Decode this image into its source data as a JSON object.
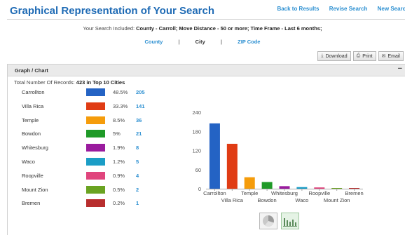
{
  "header": {
    "title": "Graphical Representation of Your Search",
    "links": [
      "Back to Results",
      "Revise Search",
      "New Search"
    ]
  },
  "criteria": {
    "prefix": "Your Search Included:",
    "value": "County - Carroll; Move Distance - 50 or more; Time Frame - Last 6 months;"
  },
  "view_tabs": [
    {
      "label": "County",
      "current": false
    },
    {
      "label": "City",
      "current": true
    },
    {
      "label": "ZIP Code",
      "current": false
    }
  ],
  "actions": [
    {
      "label": "Download",
      "icon": "download-icon"
    },
    {
      "label": "Print",
      "icon": "print-icon"
    },
    {
      "label": "Email",
      "icon": "email-icon"
    }
  ],
  "panel": {
    "title": "Graph / Chart",
    "collapse": "−"
  },
  "total": {
    "label": "Total Number Of Records:",
    "value": "423 in Top 10 Cities"
  },
  "cities": [
    {
      "name": "Carrollton",
      "color": "#2463c4",
      "pct": "48.5%",
      "count": "205"
    },
    {
      "name": "Villa Rica",
      "color": "#e03c14",
      "pct": "33.3%",
      "count": "141"
    },
    {
      "name": "Temple",
      "color": "#f59c0b",
      "pct": "8.5%",
      "count": "36"
    },
    {
      "name": "Bowdon",
      "color": "#1f9a27",
      "pct": "5%",
      "count": "21"
    },
    {
      "name": "Whitesburg",
      "color": "#9a1b9e",
      "pct": "1.9%",
      "count": "8"
    },
    {
      "name": "Waco",
      "color": "#1b9dc6",
      "pct": "1.2%",
      "count": "5"
    },
    {
      "name": "Roopville",
      "color": "#e0457d",
      "pct": "0.9%",
      "count": "4"
    },
    {
      "name": "Mount Zion",
      "color": "#6aa321",
      "pct": "0.5%",
      "count": "2"
    },
    {
      "name": "Bremen",
      "color": "#b82e2e",
      "pct": "0.2%",
      "count": "1"
    }
  ],
  "chart_data": {
    "type": "bar",
    "categories": [
      "Carrollton",
      "Villa Rica",
      "Temple",
      "Bowdon",
      "Whitesburg",
      "Waco",
      "Roopville",
      "Mount Zion",
      "Bremen"
    ],
    "values": [
      205,
      141,
      36,
      21,
      8,
      5,
      4,
      2,
      1
    ],
    "colors": [
      "#2463c4",
      "#e03c14",
      "#f59c0b",
      "#1f9a27",
      "#9a1b9e",
      "#1b9dc6",
      "#e0457d",
      "#6aa321",
      "#b82e2e"
    ],
    "ylim": [
      0,
      240
    ],
    "yticks": [
      0,
      60,
      120,
      180,
      240
    ],
    "grid": false,
    "legend": "none"
  },
  "chart_toggle": {
    "options": [
      "pie-chart-icon",
      "bar-chart-icon"
    ],
    "active": "bar-chart-icon"
  }
}
